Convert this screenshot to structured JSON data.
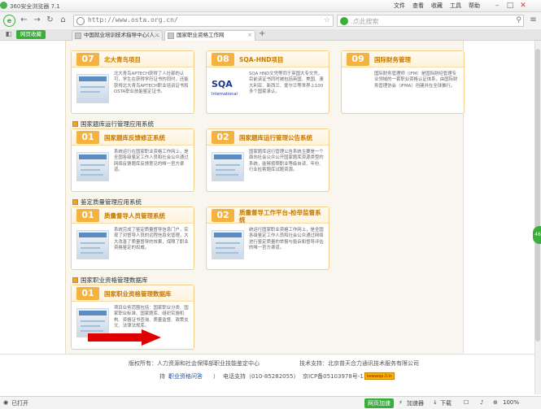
{
  "browser": {
    "title": "360安全浏览器 7.1",
    "menu": [
      "文件",
      "查看",
      "收藏",
      "工具",
      "帮助"
    ],
    "url": "http://www.osta.org.cn/",
    "search_placeholder": ".点此搜索",
    "green_button": "网页收藏",
    "tabs": [
      {
        "label": "中国就业培训技术指导中心(人…",
        "active": false
      },
      {
        "label": "国家职业资格工作网",
        "active": true
      }
    ],
    "new_tab": "+"
  },
  "sections": {
    "row1": [
      {
        "num": "07",
        "title": "北大青鸟项目",
        "desc": "北大青鸟APTECH获得了人社部的认可，学生在获得学历证书的同时，还能获得北大青鸟APTECH职业培训证书和OSTA职业技能鉴定证书。"
      },
      {
        "num": "08",
        "title": "SQA-HND项目",
        "logo": "SQA",
        "logo_sub": "International",
        "desc": "SQA HND文凭等同于英国大专文凭，目前该证书同时被包括英国、美国、澳大利亚、新西兰、爱尔兰等世界上100多个国家承认。"
      },
      {
        "num": "09",
        "title": "国际财务管理",
        "desc": "国际财务管理师（IFM）是国际财经管理专业领域的一套职业资格认证体系，由国际财务管理协会（IFMA）创建并在全球推行。"
      }
    ],
    "tiku": {
      "title": "国家题库运行管理应用系统",
      "cards": [
        {
          "num": "01",
          "title": "国家题库反馈修正系统",
          "desc": "系统运行在国家职业资格工作网上，是全国各级鉴定工作人员和社会公众通过网络反馈题库反馈意见的唯一官方渠道。"
        },
        {
          "num": "02",
          "title": "国家题库运行管理公告系统",
          "desc": "国家题库运行管理公告系统主要是一个面向社会公众公开国家题库资源类型的系统，能够按照职业等级自读、年份、行业检索题库试题资源。"
        }
      ]
    },
    "jianding": {
      "title": "鉴定质量管理应用系统",
      "cards": [
        {
          "num": "01",
          "title": "质量督导人员管理系统",
          "desc": "系统完成了鉴定质量督导信息门户，实现了对督导人员的远程信息化管理，大大改善了质量督导的效果，保障了职业资格鉴定的权威。"
        },
        {
          "num": "02",
          "title": "质量督导工作平台-检举监督系统",
          "desc": "统运行国家职业资格工作网上，是全国各级鉴定工作人员和社会公众通过网络进行鉴定质量的举报与投诉和督导评估的唯一官方渠道。"
        }
      ]
    },
    "shujuku": {
      "title": "国家职业资格管理数据库",
      "cards": [
        {
          "num": "01",
          "title": "国家职业资格管理数据库",
          "desc": "项目业务范围包括：国家职业分类、国家职业标准、国家题库、组织实施机构、资格证书查询、质量监督、政策支文、法律法规库。"
        }
      ]
    }
  },
  "footer": {
    "line1_left": "版权所有：人力资源和社会保障部职业技能鉴定中心",
    "line1_right": "技术支持：北京普天合力通讯技术服务有限公司",
    "line2_prefix": "持（",
    "line2_link": "职业资格问答",
    "line2_suffix": "）",
    "line2_tel": "电话支持（010-85282055）",
    "line2_icp": "京ICP备05103978号-1",
    "badge": "kewaiqx.ll.in"
  },
  "status": {
    "left": "已打开",
    "green": "网页加速",
    "items": [
      "加速器",
      "下载",
      "",
      "100%"
    ]
  },
  "side_badge": "46"
}
